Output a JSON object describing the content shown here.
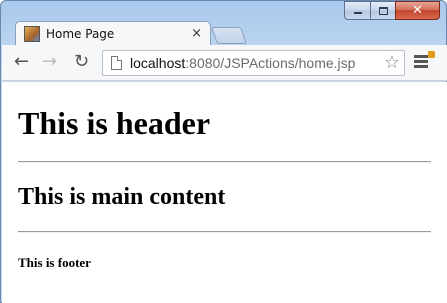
{
  "window": {
    "min_icon": "minimize-icon",
    "max_icon": "maximize-icon",
    "close_icon": "close-icon",
    "close_glyph": "✕"
  },
  "tab": {
    "title": "Home Page",
    "close_glyph": "×"
  },
  "toolbar": {
    "back_glyph": "←",
    "forward_glyph": "→",
    "reload_glyph": "↻",
    "url_host": "localhost",
    "url_rest": ":8080/JSPActions/home.jsp",
    "star_glyph": "☆"
  },
  "page": {
    "header": "This is header",
    "main": "This is main content",
    "footer": "This is footer"
  }
}
